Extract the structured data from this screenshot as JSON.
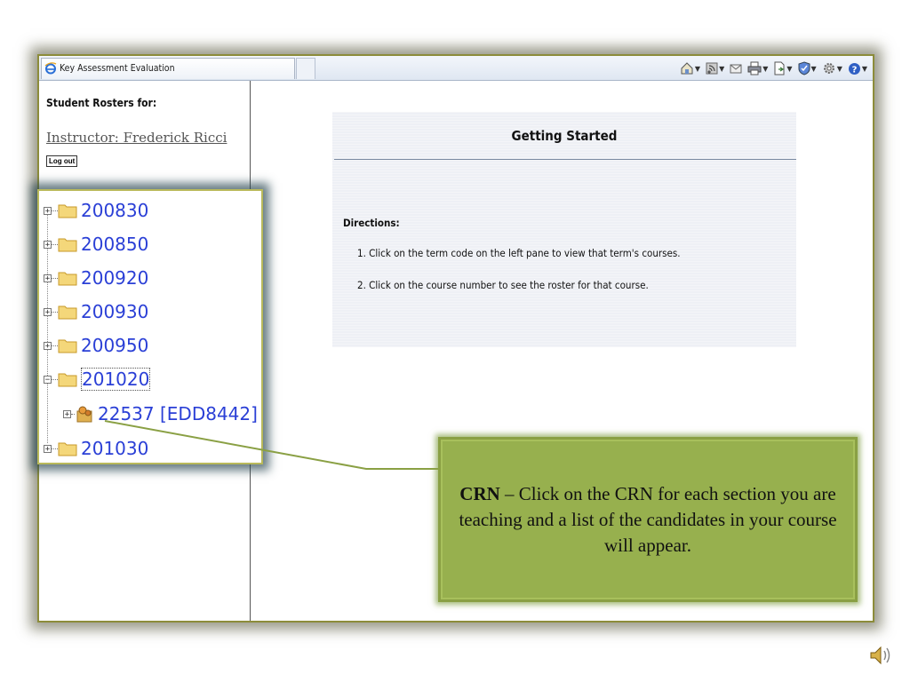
{
  "browser": {
    "tab_title": "Key Assessment Evaluation",
    "toolbar_icons": [
      "home-icon",
      "rss-feed-icon",
      "read-mail-icon",
      "print-icon",
      "page-icon",
      "safety-icon",
      "tools-icon",
      "help-icon"
    ]
  },
  "left_pane": {
    "title": "Student Rosters for:",
    "instructor_link": "Instructor: Frederick Ricci",
    "logout_label": "Log out"
  },
  "tree": {
    "terms": [
      {
        "code": "200830",
        "expanded": false
      },
      {
        "code": "200850",
        "expanded": false
      },
      {
        "code": "200920",
        "expanded": false
      },
      {
        "code": "200930",
        "expanded": false
      },
      {
        "code": "200950",
        "expanded": false
      },
      {
        "code": "201020",
        "expanded": true,
        "selected": true
      },
      {
        "code": "201030",
        "expanded": false
      }
    ],
    "course_node": "22537 [EDD8442]"
  },
  "content": {
    "title": "Getting Started",
    "directions_label": "Directions:",
    "directions": [
      "1. Click on the term code on the left pane to view that term's courses.",
      "2. Click on the course number to see the roster for that course."
    ]
  },
  "callout": {
    "bold": "CRN",
    "text": " – Click on the CRN for each section you are teaching and a list of the candidates in your course will appear."
  },
  "colors": {
    "link_blue": "#2a3fd6",
    "callout_green": "#97b04e",
    "window_border": "#8c8c3a"
  }
}
